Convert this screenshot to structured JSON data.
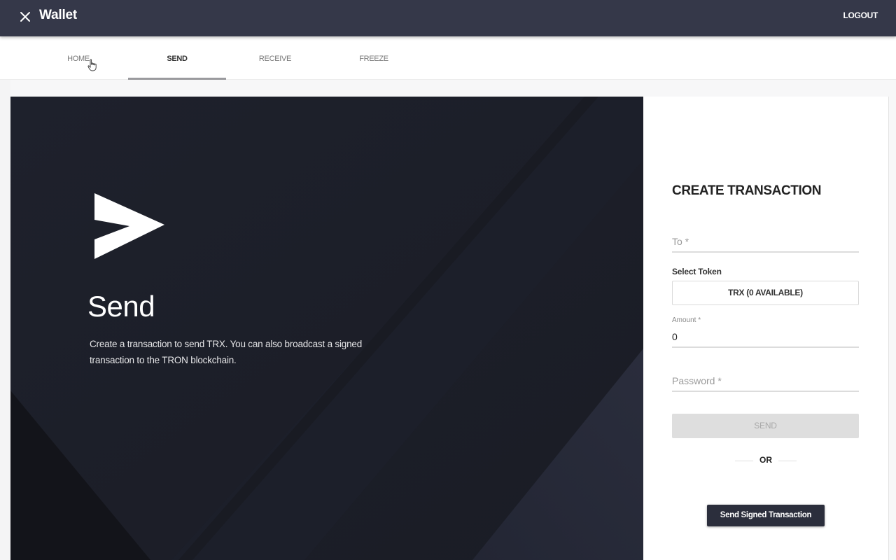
{
  "appbar": {
    "title": "Wallet",
    "close_icon": "close-icon",
    "logout_label": "LOGOUT"
  },
  "tabs": [
    {
      "label": "HOME",
      "active": false
    },
    {
      "label": "SEND",
      "active": true
    },
    {
      "label": "RECEIVE",
      "active": false
    },
    {
      "label": "FREEZE",
      "active": false
    }
  ],
  "hero": {
    "icon": "send-arrow-icon",
    "title": "Send",
    "description": "Create a transaction to send TRX. You can also broadcast a signed transaction to the TRON blockchain."
  },
  "form": {
    "title": "CREATE TRANSACTION",
    "to": {
      "placeholder": "To *",
      "value": ""
    },
    "token": {
      "label": "Select Token",
      "selected": "TRX (0 AVAILABLE)"
    },
    "amount": {
      "label": "Amount *",
      "value": "0"
    },
    "password": {
      "placeholder": "Password *",
      "value": ""
    },
    "send_label": "SEND",
    "send_disabled": true,
    "or_label": "OR",
    "signed_label": "Send Signed Transaction"
  },
  "colors": {
    "appbar": "#353849",
    "hero_bg": "#1d202b",
    "primary_button": "#2b2e3c",
    "disabled_button": "#dedede"
  }
}
